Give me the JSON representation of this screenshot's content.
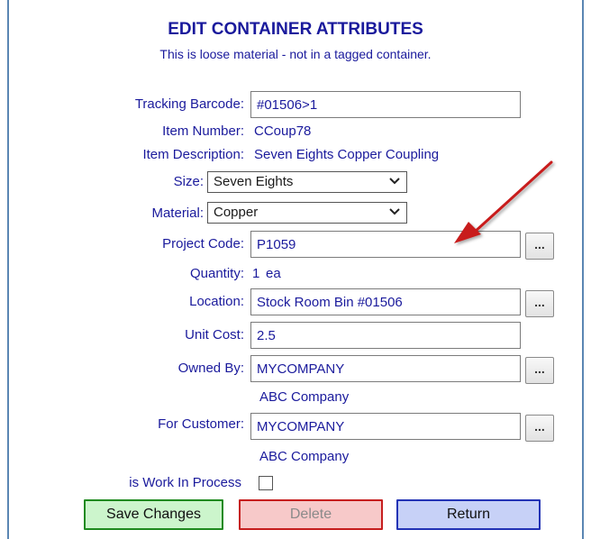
{
  "header": {
    "title": "EDIT CONTAINER ATTRIBUTES",
    "subtitle": "This is loose material - not in a tagged container."
  },
  "fields": {
    "tracking_barcode": {
      "label": "Tracking Barcode:",
      "value": "#01506>1"
    },
    "item_number": {
      "label": "Item Number:",
      "value": "CCoup78"
    },
    "item_description": {
      "label": "Item Description:",
      "value": "Seven Eights Copper Coupling"
    },
    "size": {
      "label": "Size:",
      "value": "Seven Eights"
    },
    "material": {
      "label": "Material:",
      "value": "Copper"
    },
    "project_code": {
      "label": "Project Code:",
      "value": "P1059"
    },
    "quantity": {
      "label": "Quantity:",
      "value": "1",
      "unit": "ea"
    },
    "location": {
      "label": "Location:",
      "value": "Stock Room Bin #01506"
    },
    "unit_cost": {
      "label": "Unit Cost:",
      "value": "2.5"
    },
    "owned_by": {
      "label": "Owned By:",
      "value": "MYCOMPANY",
      "name": "ABC Company"
    },
    "for_customer": {
      "label": "For Customer:",
      "value": "MYCOMPANY",
      "name": "ABC Company"
    },
    "work_in_process": {
      "label": "is Work In Process",
      "checked": false
    }
  },
  "lookup_button_label": "...",
  "buttons": {
    "save": "Save Changes",
    "delete": "Delete",
    "return": "Return"
  },
  "colors": {
    "text": "#1a1a9c",
    "frame": "#5a86b3",
    "annotation_arrow": "#c81e1e",
    "save_bg": "#ccf5cc",
    "delete_bg": "#f7c9c9",
    "return_bg": "#c7d1f7"
  }
}
